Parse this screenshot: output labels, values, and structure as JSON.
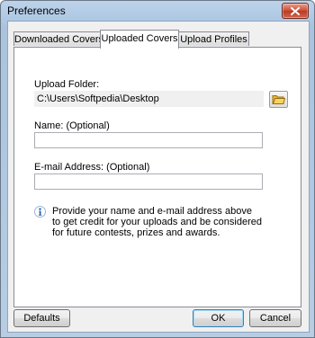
{
  "window": {
    "title": "Preferences"
  },
  "tabs": [
    {
      "label": "Downloaded Covers",
      "active": false
    },
    {
      "label": "Uploaded Covers",
      "active": true
    },
    {
      "label": "Upload Profiles",
      "active": false
    }
  ],
  "form": {
    "upload_folder_label": "Upload Folder:",
    "upload_folder_value": "C:\\Users\\Softpedia\\Desktop",
    "name_label": "Name: (Optional)",
    "name_value": "",
    "email_label": "E-mail Address: (Optional)",
    "email_value": ""
  },
  "info": {
    "lines": [
      "Provide your name and e-mail address above",
      "to get credit for your uploads and be considered",
      "for future contests, prizes and awards."
    ]
  },
  "buttons": {
    "defaults": "Defaults",
    "ok": "OK",
    "cancel": "Cancel"
  },
  "icons": {
    "close": "close-icon",
    "folder": "folder-icon",
    "info": "info-icon"
  }
}
